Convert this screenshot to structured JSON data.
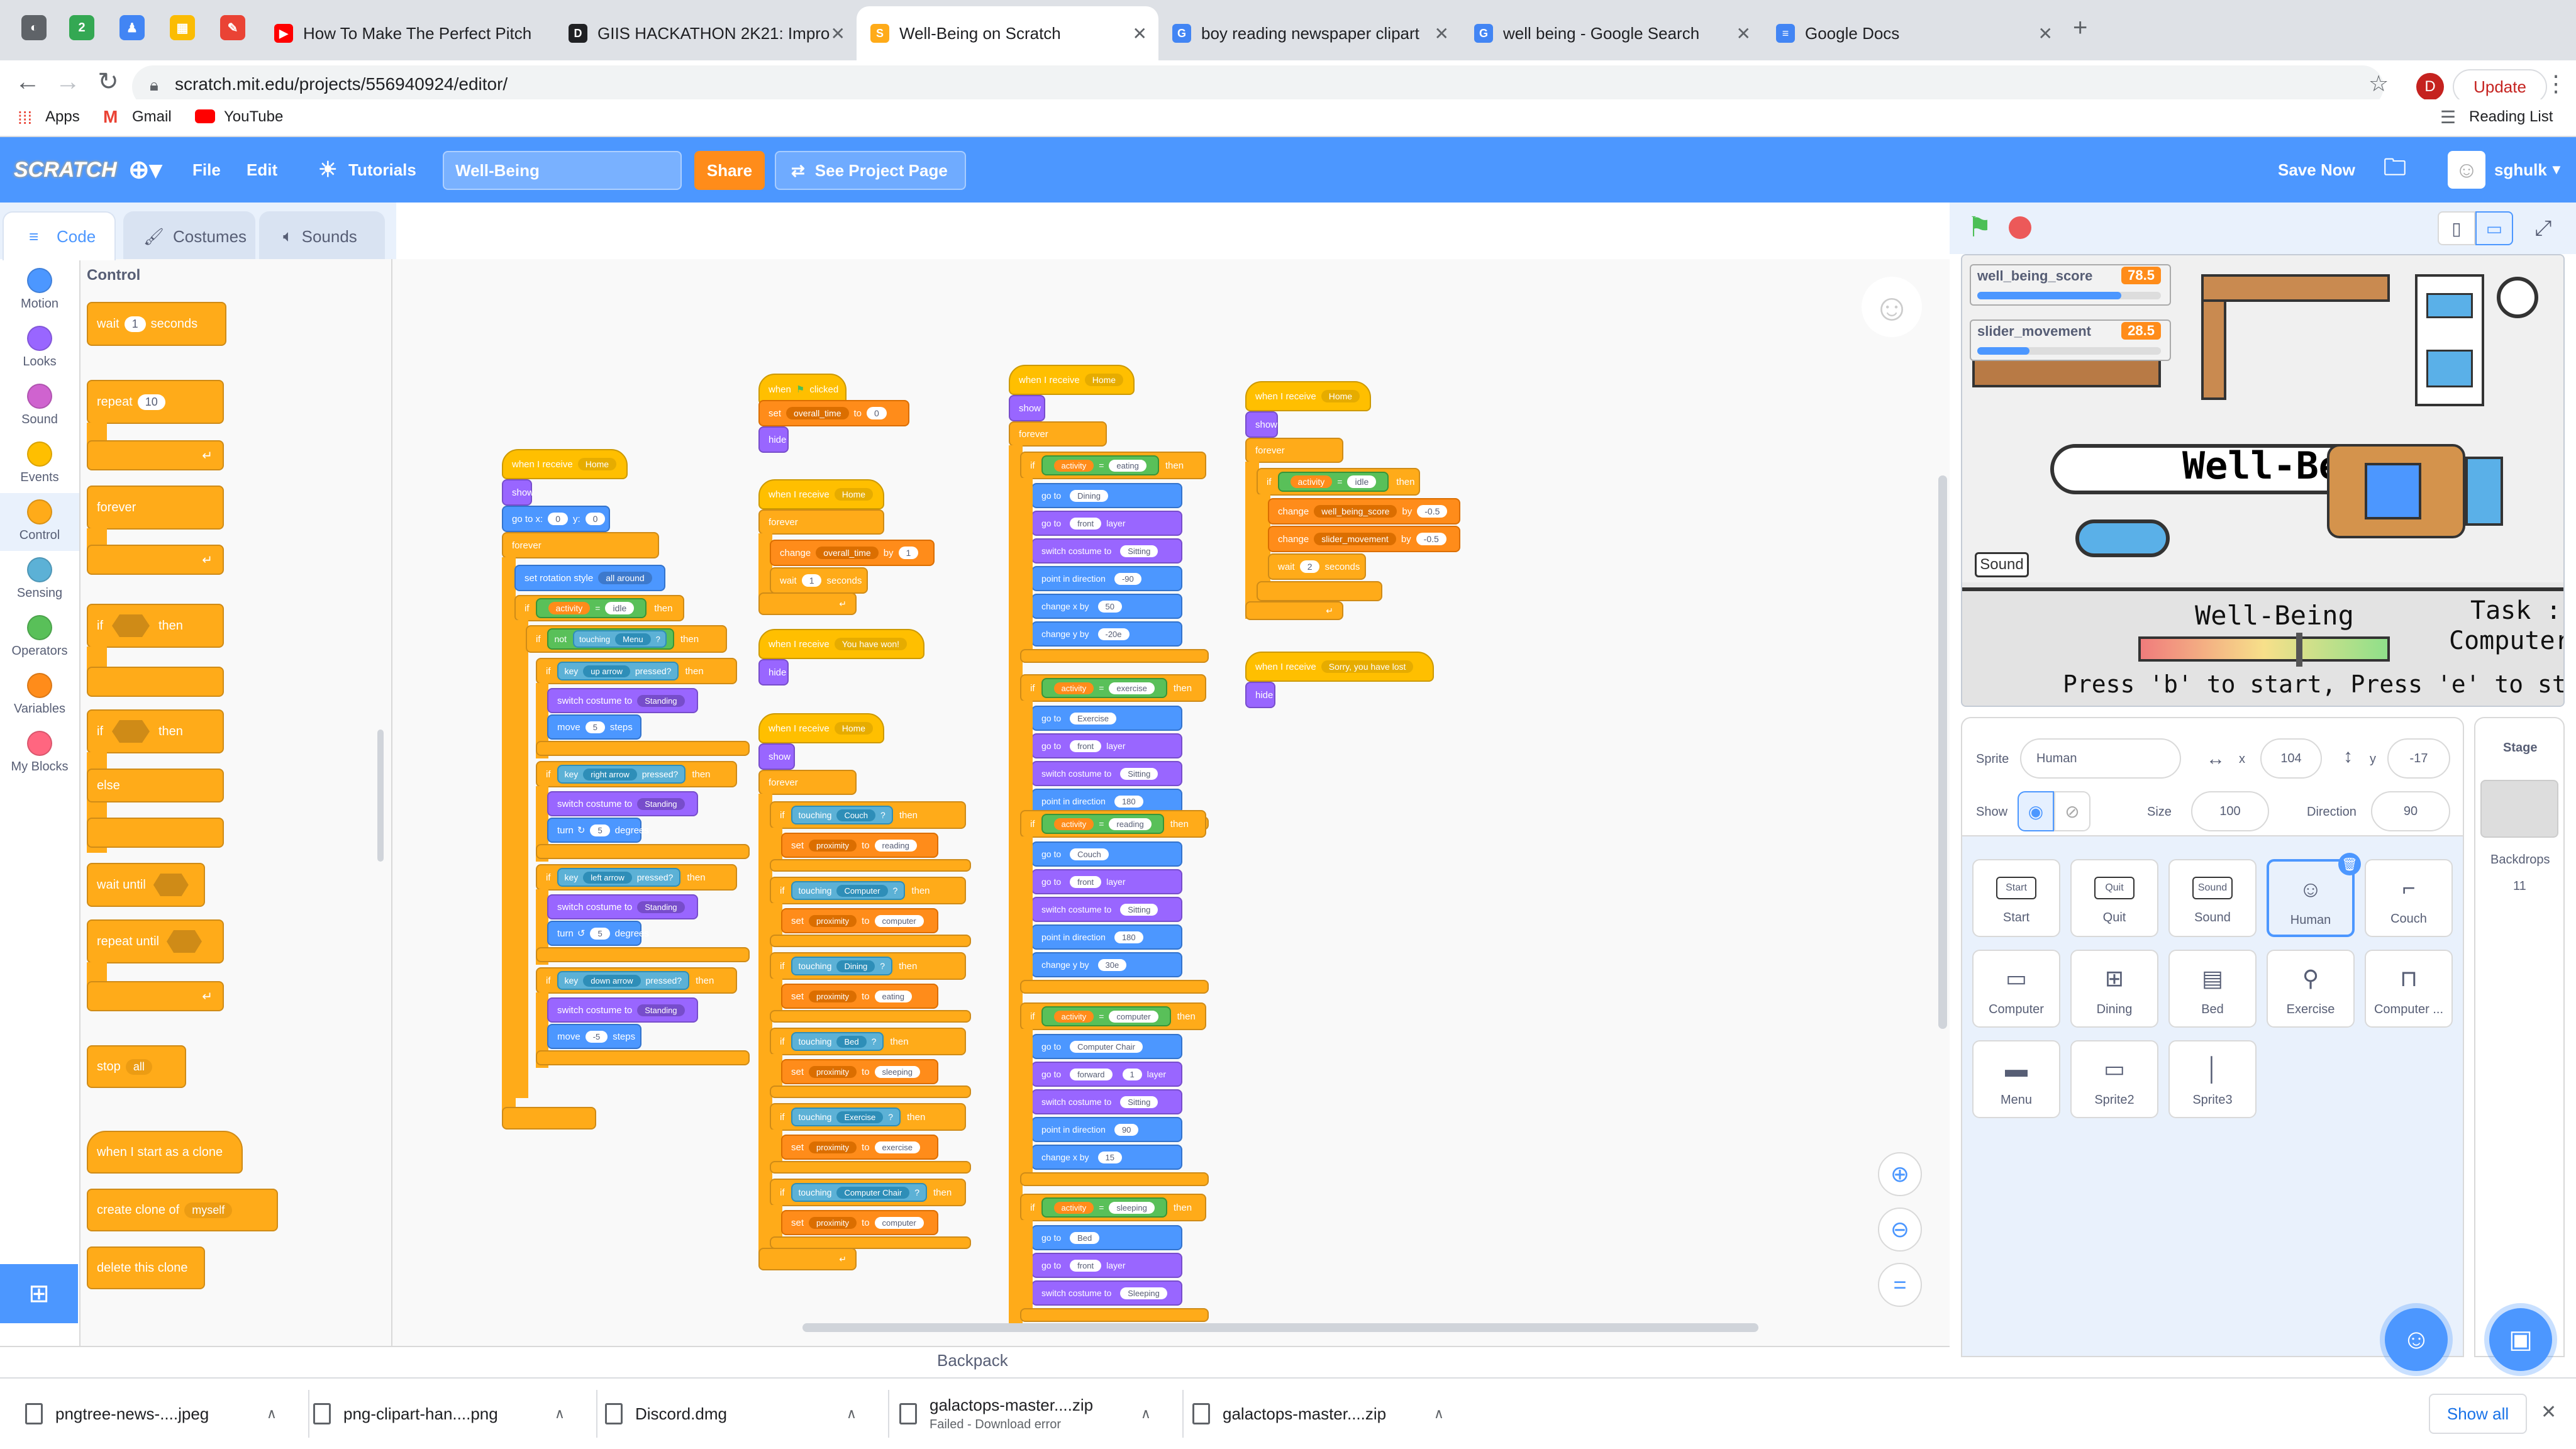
{
  "browser": {
    "tabs": [
      {
        "title": "How To Make The Perfect Pitch",
        "color": "#ff0000"
      },
      {
        "title": "GIIS HACKATHON 2K21: Impro",
        "color": "#202124"
      },
      {
        "title": "Well-Being on Scratch",
        "color": "#ffab19"
      },
      {
        "title": "boy reading newspaper clipart",
        "color": "#4285f4"
      },
      {
        "title": "well being - Google Search",
        "color": "#4285f4"
      },
      {
        "title": "Google Docs",
        "color": "#4285f4"
      }
    ],
    "url": "scratch.mit.edu/projects/556940924/editor/",
    "profile_initial": "D",
    "update_label": "Update",
    "bookmarks": [
      "Apps",
      "Gmail",
      "YouTube"
    ],
    "reading_list": "Reading List"
  },
  "menubar": {
    "logo": "SCRATCH",
    "file": "File",
    "edit": "Edit",
    "tutorials": "Tutorials",
    "project_title": "Well-Being",
    "share": "Share",
    "see_project": "See Project Page",
    "save_now": "Save Now",
    "username": "sghulk"
  },
  "editor_tabs": {
    "code": "Code",
    "costumes": "Costumes",
    "sounds": "Sounds"
  },
  "categories": [
    {
      "label": "Motion",
      "color": "#4c97ff"
    },
    {
      "label": "Looks",
      "color": "#9966ff"
    },
    {
      "label": "Sound",
      "color": "#cf63cf"
    },
    {
      "label": "Events",
      "color": "#ffbf00"
    },
    {
      "label": "Control",
      "color": "#ffab19"
    },
    {
      "label": "Sensing",
      "color": "#5cb1d6"
    },
    {
      "label": "Operators",
      "color": "#59c059"
    },
    {
      "label": "Variables",
      "color": "#ff8c1a"
    },
    {
      "label": "My Blocks",
      "color": "#ff6680"
    }
  ],
  "palette": {
    "heading": "Control",
    "wait": "wait",
    "wait_val": "1",
    "seconds": "seconds",
    "repeat": "repeat",
    "repeat_val": "10",
    "forever": "forever",
    "if": "if",
    "then": "then",
    "else": "else",
    "wait_until": "wait until",
    "repeat_until": "repeat until",
    "stop": "stop",
    "stop_val": "all",
    "when_clone": "when I start as a clone",
    "create_clone": "create clone of",
    "create_clone_val": "myself",
    "delete_clone": "delete this clone"
  },
  "scripts": {
    "s1": {
      "hat": "when I receive",
      "hat_val": "Home",
      "show": "show",
      "goto": "go to x:",
      "gx": "0",
      "gy_lbl": "y:",
      "gy": "0",
      "forever": "forever",
      "rot": "set rotation style",
      "rot_val": "all around",
      "if": "if",
      "activity": "activity",
      "idle": "idle",
      "then": "then",
      "not": "not",
      "touching": "touching",
      "menu": "Menu",
      "key": "key",
      "up": "up arrow",
      "pressed": "pressed?",
      "switch": "switch costume to",
      "standing": "Standing",
      "move": "move",
      "steps": "steps",
      "five": "5",
      "right": "right arrow",
      "turn": "turn",
      "degrees": "degrees",
      "left": "left arrow",
      "down": "down arrow",
      "neg5": "-5"
    },
    "s2": {
      "hat": "when",
      "clicked": "clicked",
      "set": "set",
      "var": "overall_time",
      "to": "to",
      "zero": "0",
      "hide": "hide"
    },
    "s3": {
      "hat": "when I receive",
      "hat_val": "Home",
      "forever": "forever",
      "change": "change",
      "var": "overall_time",
      "by": "by",
      "one": "1",
      "wait": "wait",
      "seconds": "seconds"
    },
    "s4": {
      "hat": "when I receive",
      "hat_val": "You have won!",
      "hide": "hide"
    },
    "s5": {
      "hat": "when I receive",
      "hat_val": "Home",
      "show": "show",
      "forever": "forever",
      "rows": [
        {
          "obj": "Couch",
          "act": "reading"
        },
        {
          "obj": "Computer",
          "act": "computer"
        },
        {
          "obj": "Dining",
          "act": "eating"
        },
        {
          "obj": "Bed",
          "act": "sleeping"
        },
        {
          "obj": "Exercise",
          "act": "exercise"
        },
        {
          "obj": "Computer Chair",
          "act": "computer"
        }
      ],
      "touching": "touching",
      "set": "set",
      "proximity": "proximity",
      "to": "to"
    },
    "s6": {
      "hat": "when I receive",
      "hat_val": "Home",
      "show": "show",
      "forever": "forever",
      "activity": "activity",
      "groups": [
        {
          "act": "eating",
          "goto": "Dining",
          "front": "front",
          "costume": "Sitting",
          "dir": "-90",
          "cx": "50",
          "cy": "-20e"
        },
        {
          "act": "exercise",
          "goto": "Exercise",
          "front": "front",
          "costume": "Sitting",
          "dir": "180"
        },
        {
          "act": "reading",
          "goto": "Couch",
          "front": "front",
          "costume": "Sitting",
          "dir": "180",
          "cy": "30e"
        },
        {
          "act": "computer",
          "goto": "Computer Chair",
          "front": "forward",
          "layers": "1",
          "costume": "Sitting",
          "dir": "90",
          "cx": "15"
        },
        {
          "act": "sleeping",
          "goto": "Bed",
          "front": "front",
          "costume": "Sleeping"
        }
      ],
      "go_to": "go to",
      "layer": "layer",
      "switch": "switch costume to",
      "point": "point in direction",
      "changex": "change x by",
      "changey": "change y by"
    },
    "s7": {
      "hat": "when I receive",
      "hat_val": "Home",
      "show": "show",
      "forever": "forever",
      "if": "if",
      "activity": "activity",
      "idle": "idle",
      "then": "then",
      "change": "change",
      "v1": "well_being_score",
      "v2": "slider_movement",
      "by": "by",
      "neg": "-0.5",
      "wait": "wait",
      "two": "2",
      "seconds": "seconds"
    },
    "s8": {
      "hat": "when I receive",
      "hat_val": "Sorry, you have lost",
      "hide": "hide"
    }
  },
  "stage": {
    "monitors": [
      {
        "name": "well_being_score",
        "value": "78.5",
        "level": 0.785
      },
      {
        "name": "slider_movement",
        "value": "28.5",
        "level": 0.285
      }
    ],
    "sound_btn": "Sound",
    "banner": "Well-Bein",
    "bar_title": "Well-Being",
    "bar_level": 0.63,
    "task_label": "Task :",
    "task_value": "Computer",
    "instructions": "Press 'b' to start, Press 'e' to stop"
  },
  "sprite_info": {
    "sprite_label": "Sprite",
    "sprite_name": "Human",
    "x_label": "x",
    "x": "104",
    "y_label": "y",
    "y": "-17",
    "show_label": "Show",
    "size_label": "Size",
    "size": "100",
    "direction_label": "Direction",
    "direction": "90"
  },
  "sprites": [
    {
      "name": "Start",
      "icon": "Start"
    },
    {
      "name": "Quit",
      "icon": "Quit"
    },
    {
      "name": "Sound",
      "icon": "Sound"
    },
    {
      "name": "Human",
      "icon": "☺"
    },
    {
      "name": "Couch",
      "icon": "⌐"
    },
    {
      "name": "Computer",
      "icon": "▭"
    },
    {
      "name": "Dining",
      "icon": "⊞"
    },
    {
      "name": "Bed",
      "icon": "▤"
    },
    {
      "name": "Exercise",
      "icon": "⚲"
    },
    {
      "name": "Computer ...",
      "icon": "⊓"
    },
    {
      "name": "Menu",
      "icon": "▬"
    },
    {
      "name": "Sprite2",
      "icon": "▭"
    },
    {
      "name": "Sprite3",
      "icon": "│"
    }
  ],
  "stage_pane": {
    "title": "Stage",
    "backdrops": "Backdrops",
    "backdrop_count": "11"
  },
  "backpack": "Backpack",
  "downloads": [
    {
      "name": "pngtree-news-....jpeg",
      "status": ""
    },
    {
      "name": "png-clipart-han....png",
      "status": ""
    },
    {
      "name": "Discord.dmg",
      "status": ""
    },
    {
      "name": "galactops-master....zip",
      "status": "Failed - Download error"
    },
    {
      "name": "galactops-master....zip",
      "status": ""
    }
  ],
  "show_all": "Show all"
}
